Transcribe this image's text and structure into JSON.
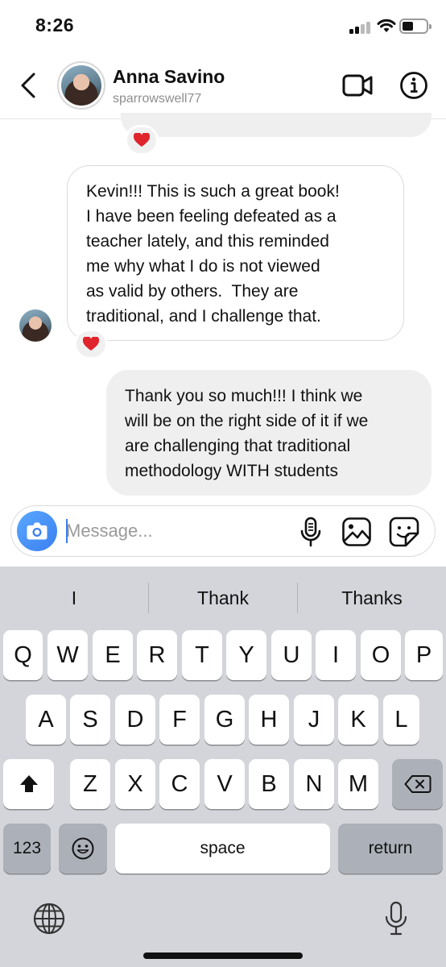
{
  "status_bar": {
    "time": "8:26"
  },
  "header": {
    "contact_name": "Anna Savino",
    "contact_handle": "sparrowswell77",
    "icons": [
      "back-chevron-icon",
      "video-camera-icon",
      "info-icon"
    ]
  },
  "messages": [
    {
      "direction": "received",
      "lines": [
        "Kevin!!! This is such a great book!",
        "I have been feeling defeated as a",
        "teacher lately, and this reminded",
        "me why what I do is not viewed",
        "as valid by others.  They are",
        "traditional, and I challenge that."
      ],
      "reaction": "heart"
    },
    {
      "direction": "sent",
      "lines": [
        "Thank you so much!!! I think we",
        "will be on the right side of it if we",
        "are challenging that traditional",
        "methodology WITH students"
      ]
    }
  ],
  "composer": {
    "placeholder": "Message...",
    "value": "",
    "icons": [
      "camera-icon",
      "microphone-icon",
      "gallery-icon",
      "sticker-icon"
    ]
  },
  "keyboard": {
    "suggestions": [
      "I",
      "Thank",
      "Thanks"
    ],
    "row1": [
      "Q",
      "W",
      "E",
      "R",
      "T",
      "Y",
      "U",
      "I",
      "O",
      "P"
    ],
    "row2": [
      "A",
      "S",
      "D",
      "F",
      "G",
      "H",
      "J",
      "K",
      "L"
    ],
    "row3": [
      "Z",
      "X",
      "C",
      "V",
      "B",
      "N",
      "M"
    ],
    "numbers_label": "123",
    "space_label": "space",
    "return_label": "return"
  },
  "colors": {
    "accent": "#3a7ff0",
    "reaction": "#e0242b",
    "sent_bubble": "#efefef",
    "keyboard_bg": "#d3d5da"
  }
}
